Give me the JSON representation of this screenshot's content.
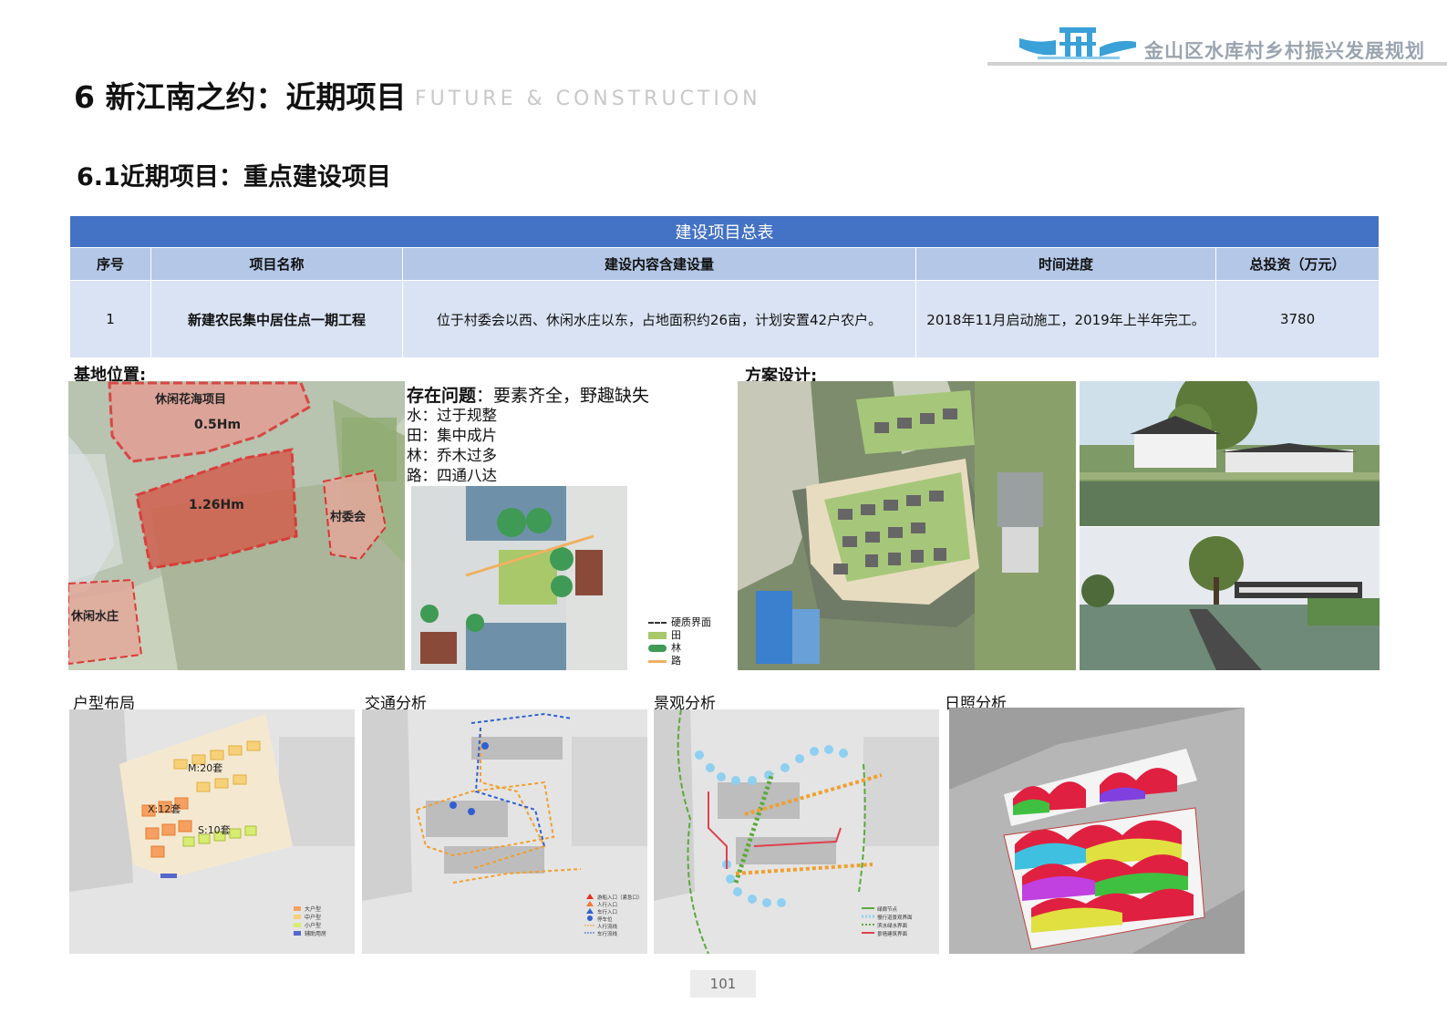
{
  "header": {
    "brand": "金山区水库村乡村振兴发展规划",
    "title": "6 新江南之约：近期项目",
    "subtitle": "FUTURE & CONSTRUCTION",
    "section": "6.1近期项目：重点建设项目"
  },
  "table": {
    "caption": "建设项目总表",
    "columns": [
      "序号",
      "项目名称",
      "建设内容含建设量",
      "时间进度",
      "总投资（万元）"
    ],
    "rows": [
      [
        "1",
        "新建农民集中居住点一期工程",
        "位于村委会以西、休闲水庄以东，占地面积约26亩，计划安置42户农户。",
        "2018年11月启动施工，2019年上半年完工。",
        "3780"
      ]
    ]
  },
  "site": {
    "label": "基地位置:",
    "map_labels": {
      "flower_sea": "休闲花海项目",
      "area_a": "0.5Hm",
      "area_b": "1.26Hm",
      "village_committee": "村委会",
      "water_resort": "休闲水庄"
    }
  },
  "problems": {
    "title_bold": "存在问题",
    "title_rest": "：要素齐全，野趣缺失",
    "items": [
      "水：过于规整",
      "田：集中成片",
      "林：乔木过多",
      "路：四通八达"
    ]
  },
  "legend": {
    "hard": "硬质界面",
    "field": "田",
    "forest": "林",
    "road": "路"
  },
  "design": {
    "label": "方案设计:"
  },
  "analysis": {
    "layout": {
      "title": "户型布局",
      "m": "M:20套",
      "x": "X:12套",
      "s": "S:10套",
      "legend": [
        "大户型",
        "中户型",
        "小户型",
        "辅助用房"
      ]
    },
    "traffic": {
      "title": "交通分析",
      "legend": [
        "游船入口（紧急口）",
        "人行入口",
        "车行入口",
        "停车位",
        "人行流线",
        "车行流线"
      ]
    },
    "landscape": {
      "title": "景观分析",
      "legend": [
        "绿廊节点",
        "慢行道景观界面",
        "滨水绿水界面",
        "景墙建筑界面"
      ]
    },
    "sun": {
      "title": "日照分析"
    }
  },
  "footer": {
    "page": "101"
  },
  "colors": {
    "table_caption": "#4472c4",
    "table_header": "#b4c7e7",
    "table_row": "#dae3f3",
    "brand": "#9aa4b0"
  }
}
